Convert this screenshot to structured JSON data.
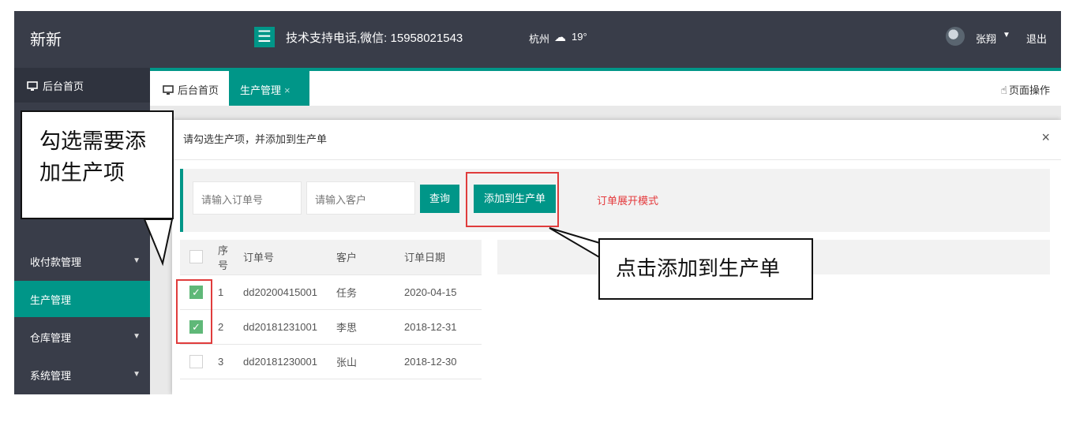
{
  "header": {
    "brand": "新新",
    "menu_icon": "hamburger-icon",
    "support_text": "技术支持电话,微信: 15958021543",
    "city": "杭州",
    "weather_icon": "cloud-icon",
    "temperature": "19°",
    "user_name": "张翔",
    "logout": "退出"
  },
  "sidebar": {
    "home": "后台首页",
    "items": [
      {
        "label": "收付款管理"
      },
      {
        "label": "生产管理"
      },
      {
        "label": "仓库管理"
      },
      {
        "label": "系统管理"
      }
    ]
  },
  "tabs": [
    {
      "label": "后台首页"
    },
    {
      "label": "生产管理",
      "close": "×"
    }
  ],
  "page_ops": "页面操作",
  "dialog": {
    "title": "请勾选生产项，并添加到生产单",
    "close": "×",
    "order_placeholder": "请输入订单号",
    "customer_placeholder": "请输入客户",
    "query_button": "查询",
    "add_button": "添加到生产单",
    "expand_mode": "订单展开模式",
    "columns": [
      "序号",
      "订单号",
      "客户",
      "订单日期"
    ],
    "rows": [
      {
        "no": "1",
        "order": "dd20200415001",
        "customer": "任务",
        "date": "2020-04-15",
        "checked": true
      },
      {
        "no": "2",
        "order": "dd20181231001",
        "customer": "李思",
        "date": "2018-12-31",
        "checked": true
      },
      {
        "no": "3",
        "order": "dd20181230001",
        "customer": "张山",
        "date": "2018-12-30",
        "checked": false
      }
    ]
  },
  "annotations": {
    "left_note": "勾选需要添加生产项",
    "left_line1": "勾选需要添",
    "left_line2": "加生产项",
    "right_note": "点击添加到生产单"
  },
  "colors": {
    "accent": "#009688",
    "dark_bar": "#393d49",
    "highlight_red": "#e03c3c",
    "checkbox_green": "#5fb878"
  }
}
